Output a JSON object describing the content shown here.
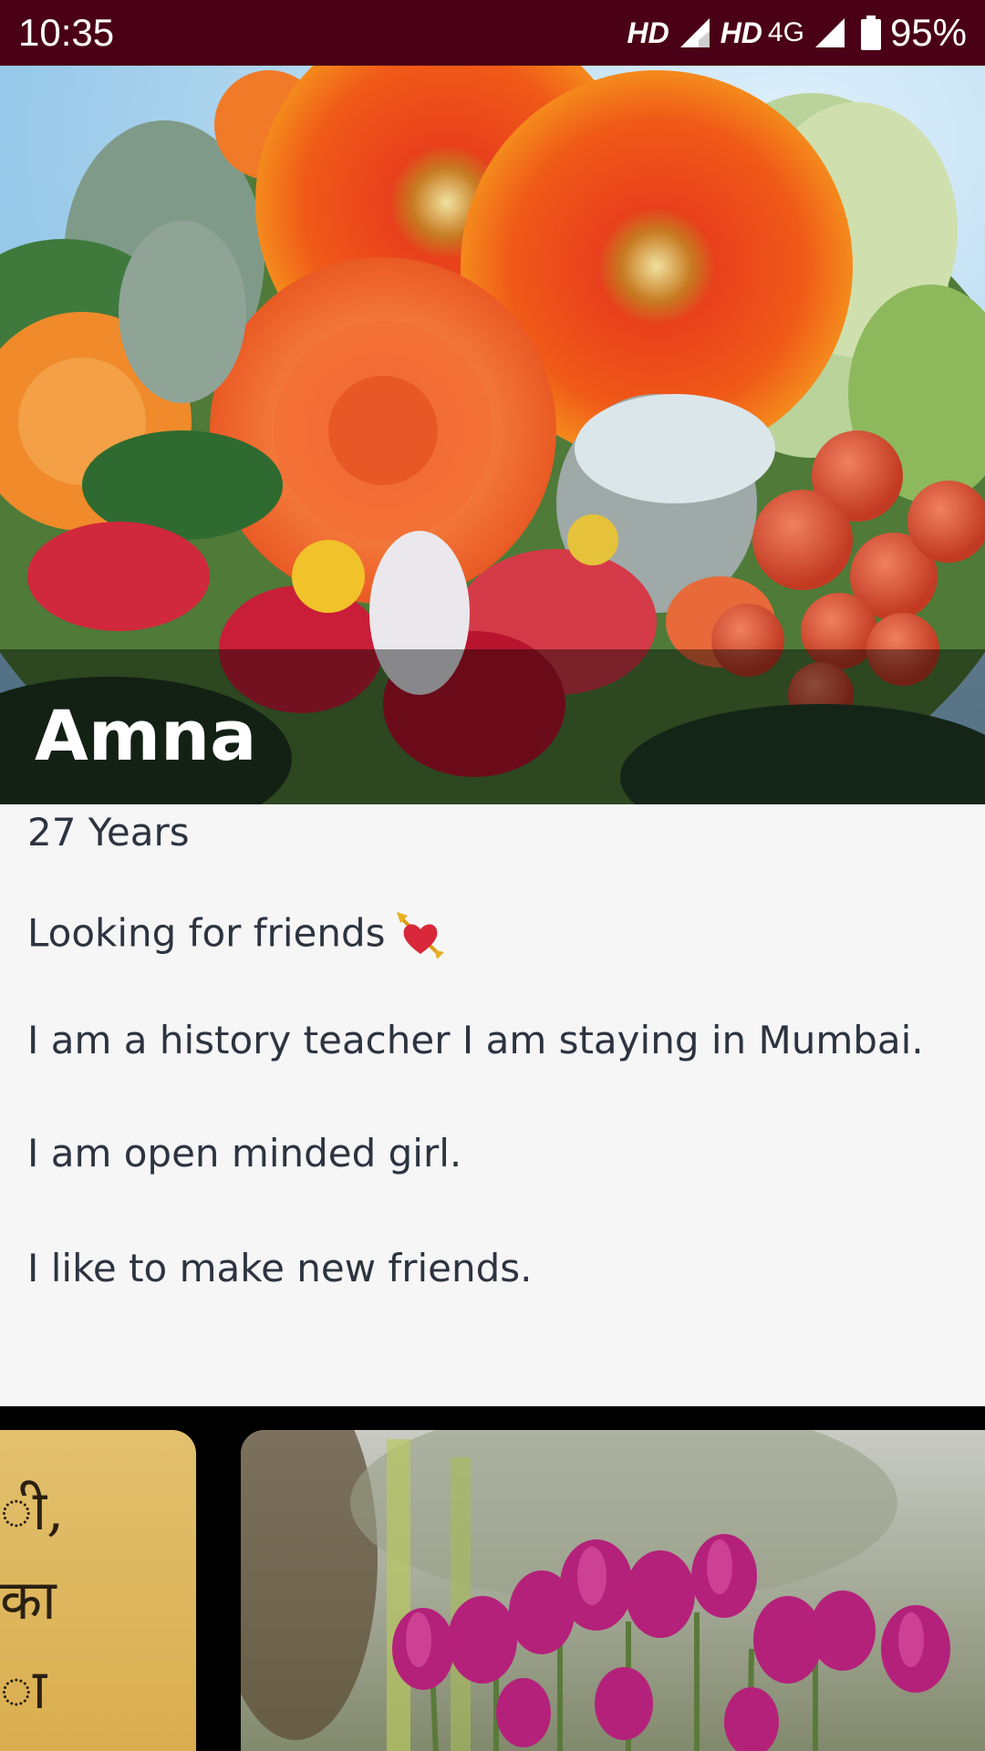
{
  "status_bar": {
    "time": "10:35",
    "network_1": "HD",
    "network_2": "HD",
    "network_2_type": "4G",
    "battery": "95%",
    "icons": [
      "signal-icon",
      "signal-icon",
      "battery-icon"
    ]
  },
  "profile": {
    "name": "Amna",
    "age": "27 Years",
    "bio_lines": [
      "Looking for friends",
      "I am a history teacher I am staying in Mumbai.",
      "I am open minded girl.",
      "I like to make new friends."
    ],
    "emoji": "heart-with-arrow-icon"
  },
  "gallery": {
    "left_card_glyphs": [
      "ी,",
      "का",
      "ा"
    ]
  },
  "colors": {
    "status_bar": "#4a0016",
    "bio_background": "#f6f6f7",
    "text": "#2d3440"
  }
}
